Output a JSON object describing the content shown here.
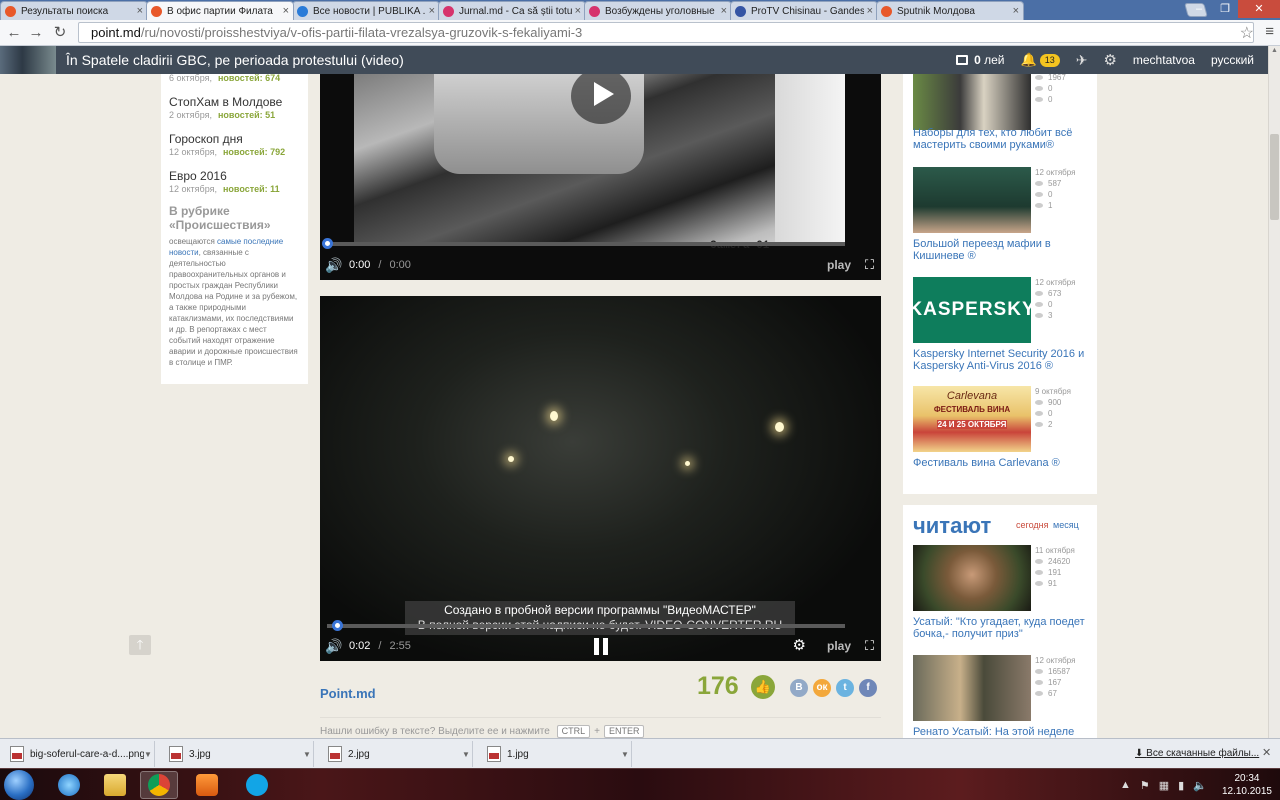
{
  "browser": {
    "tabs": [
      {
        "title": "Результаты поиска",
        "color": "#e8582a",
        "active": false
      },
      {
        "title": "В офис партии Филата",
        "color": "#e8582a",
        "active": true
      },
      {
        "title": "Все новости | PUBLIKA .M",
        "color": "#2a7bd8",
        "active": false
      },
      {
        "title": "Jurnal.md - Ca să știi totul",
        "color": "#d6336c",
        "active": false
      },
      {
        "title": "Возбуждены уголовные",
        "color": "#d6336c",
        "active": false
      },
      {
        "title": "ProTV Chisinau - Gandeste",
        "color": "#3454a4",
        "active": false
      },
      {
        "title": "Sputnik Молдова",
        "color": "#e8582a",
        "active": false
      }
    ],
    "url_host": "point.md",
    "url_path": "/ru/novosti/proisshestviya/v-ofis-partii-filata-vrezalsya-gruzovik-s-fekaliyami-3"
  },
  "header": {
    "title": "În Spatele cladirii GBC, pe perioada protestului (video)",
    "balance": "0",
    "balance_unit": "лей",
    "notifications": "13",
    "username": "mechtatvoa",
    "language": "русский"
  },
  "left": {
    "items": [
      {
        "title": "",
        "date": "6 октября,",
        "count": "новостей: 674"
      },
      {
        "title": "СтопХам в Молдове",
        "date": "2 октября,",
        "count": "новостей: 51"
      },
      {
        "title": "Гороскоп дня",
        "date": "12 октября,",
        "count": "новостей: 792"
      },
      {
        "title": "Евро 2016",
        "date": "12 октября,",
        "count": "новостей: 11"
      }
    ],
    "rubric_title": "В рубрике «Происшествия»",
    "rubric_pre": "освещаются ",
    "rubric_link": "самые последние новости",
    "rubric_post": ", связанные с деятельностью правоохранительных органов и простых граждан Республики Молдова на Родине и за рубежом, а также природными катаклизмами, их последствиями и др. В репортажах с мест событий находят отражение аварии и дорожные происшествия в столице и ПМР."
  },
  "video1": {
    "time": "0:00",
    "duration": "0:00",
    "progress": 0.0,
    "brand": "play",
    "stamp": "Camera 01"
  },
  "video2": {
    "time": "0:02",
    "duration": "2:55",
    "progress": 0.02,
    "brand": "play",
    "watermark_line1": "Создано в пробной версии программы \"ВидеоМАСТЕР\"",
    "watermark_line2": "В полной версии этой надписи не будет. VIDEO-CONVERTER.RU"
  },
  "article": {
    "source": "Point.md",
    "likes": "176",
    "social": [
      {
        "label": "В",
        "color": "#92a9c7"
      },
      {
        "label": "ок",
        "color": "#f3a83b"
      },
      {
        "label": "t",
        "color": "#6bb3e0"
      },
      {
        "label": "f",
        "color": "#6f87b8"
      }
    ],
    "error_text": "Нашли ошибку в тексте? Выделите ее и нажмите",
    "key1": "CTRL",
    "plus": "+",
    "key2": "ENTER"
  },
  "right": {
    "top_item": {
      "title": "Наборы для тех, кто любит всё мастерить своими руками®",
      "views": "1967",
      "comments": "0",
      "likes": "0"
    },
    "items": [
      {
        "title": "Большой переезд мафии в Кишиневе ®",
        "date": "12 октября",
        "views": "587",
        "comments": "0",
        "likes": "1"
      },
      {
        "title": "Kaspersky Internet Security 2016 и Kaspersky Anti-Virus 2016 ®",
        "date": "12 октября",
        "views": "673",
        "comments": "0",
        "likes": "3"
      },
      {
        "title": "Фестиваль вина Carlevana ®",
        "date": "9 октября",
        "views": "900",
        "comments": "0",
        "likes": "2"
      }
    ],
    "kaspersky_logo": "KASPERSKY",
    "carlevana_logo": "Carlevana",
    "carlevana_banner": "ФЕСТИВАЛЬ ВИНА",
    "carlevana_dates": "24 И 25 ОКТЯБРЯ"
  },
  "reading": {
    "title": "читают",
    "tab_today": "сегодня",
    "tab_month": "месяц",
    "items": [
      {
        "title": "Усатый: \"Кто угадает, куда поедет бочка,- получит приз\"",
        "date": "11 октября",
        "views": "24620",
        "comments": "191",
        "likes": "91"
      },
      {
        "title": "Ренато Усатый: На этой неделе",
        "date": "12 октября",
        "views": "16587",
        "comments": "167",
        "likes": "67"
      }
    ]
  },
  "downloads": {
    "files": [
      "big-soferul-care-a-d....png",
      "3.jpg",
      "2.jpg",
      "1.jpg"
    ],
    "show_all": "Все скачанные файлы..."
  },
  "taskbar": {
    "time": "20:34",
    "date": "12.10.2015"
  }
}
